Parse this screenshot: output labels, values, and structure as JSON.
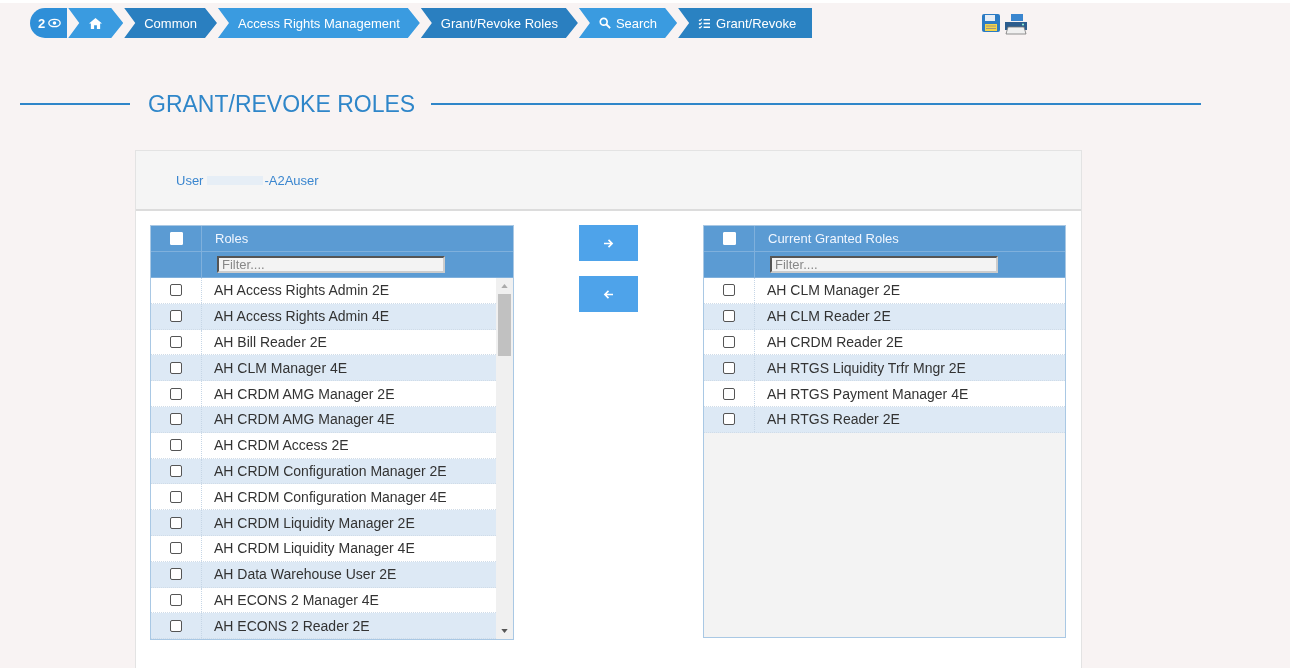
{
  "breadcrumb": {
    "counter": "2",
    "items": [
      {
        "kind": "home",
        "selected": false
      },
      {
        "kind": "text",
        "label": "Common",
        "selected": false
      },
      {
        "kind": "text",
        "label": "Access Rights Management",
        "selected": false
      },
      {
        "kind": "text",
        "label": "Grant/Revoke Roles",
        "selected": false
      },
      {
        "kind": "search",
        "label": "Search",
        "selected": false
      },
      {
        "kind": "list",
        "label": "Grant/Revoke",
        "selected": true
      }
    ]
  },
  "title": "GRANT/REVOKE ROLES",
  "user": {
    "label": "User",
    "value": "-A2Auser"
  },
  "available": {
    "header": "Roles",
    "header_checked": false,
    "filter_placeholder": "Filter....",
    "rows": [
      {
        "name": "AH Access Rights Admin 2E",
        "checked": false
      },
      {
        "name": "AH Access Rights Admin 4E",
        "checked": false
      },
      {
        "name": "AH Bill Reader 2E",
        "checked": false
      },
      {
        "name": "AH CLM Manager 4E",
        "checked": false
      },
      {
        "name": "AH CRDM AMG Manager 2E",
        "checked": false
      },
      {
        "name": "AH CRDM AMG Manager 4E",
        "checked": false
      },
      {
        "name": "AH CRDM Access 2E",
        "checked": false
      },
      {
        "name": "AH CRDM Configuration Manager 2E",
        "checked": false
      },
      {
        "name": "AH CRDM Configuration Manager 4E",
        "checked": false
      },
      {
        "name": "AH CRDM Liquidity Manager 2E",
        "checked": false
      },
      {
        "name": "AH CRDM Liquidity Manager 4E",
        "checked": false
      },
      {
        "name": "AH Data Warehouse User 2E",
        "checked": false
      },
      {
        "name": "AH ECONS 2 Manager 4E",
        "checked": false
      },
      {
        "name": "AH ECONS 2 Reader 2E",
        "checked": false
      }
    ]
  },
  "granted": {
    "header": "Current Granted Roles",
    "header_checked": false,
    "filter_placeholder": "Filter....",
    "rows": [
      {
        "name": "AH CLM Manager 2E",
        "checked": false
      },
      {
        "name": "AH CLM Reader 2E",
        "checked": false
      },
      {
        "name": "AH CRDM Reader 2E",
        "checked": false
      },
      {
        "name": "AH RTGS Liquidity Trfr Mngr 2E",
        "checked": false
      },
      {
        "name": "AH RTGS Payment Manager 4E",
        "checked": false
      },
      {
        "name": "AH RTGS Reader 2E",
        "checked": false
      }
    ]
  }
}
